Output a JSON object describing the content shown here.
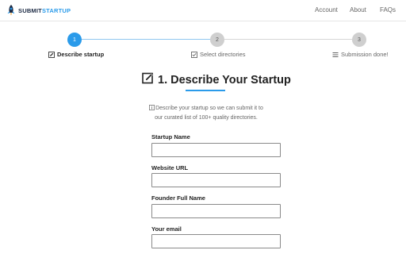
{
  "brand": {
    "name_part1": "SUBMIT",
    "name_part2": "STARTUP",
    "icon": "rocket-icon",
    "colors": {
      "dark": "#1c2a44",
      "accent": "#2b9bea"
    }
  },
  "nav": {
    "account": "Account",
    "about": "About",
    "faqs": "FAQs"
  },
  "stepper": {
    "current_step": 1,
    "steps": [
      {
        "number": "1",
        "label": "Describe startup",
        "icon": "edit-icon",
        "status": "active"
      },
      {
        "number": "2",
        "label": "Select directories",
        "icon": "checkbox-icon",
        "status": "pending"
      },
      {
        "number": "3",
        "label": "Submission done!",
        "icon": "list-icon",
        "status": "pending"
      }
    ]
  },
  "main": {
    "title": "1. Describe Your Startup",
    "title_icon": "edit-icon",
    "description_line1": "Describe your startup so we can submit it to",
    "description_line2": "our curated list of 100+ quality directories.",
    "description_icon": "info-icon"
  },
  "form": {
    "fields": [
      {
        "label": "Startup Name",
        "value": "",
        "placeholder": ""
      },
      {
        "label": "Website URL",
        "value": "",
        "placeholder": ""
      },
      {
        "label": "Founder Full Name",
        "value": "",
        "placeholder": ""
      },
      {
        "label": "Your email",
        "value": "",
        "placeholder": ""
      }
    ]
  }
}
